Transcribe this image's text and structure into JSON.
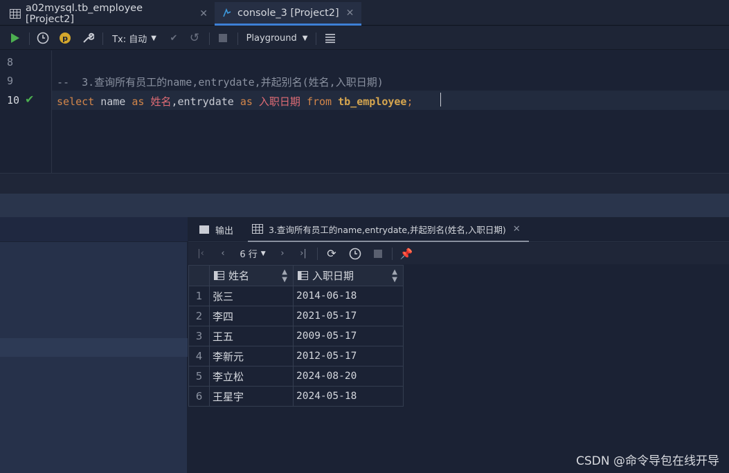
{
  "tabs": [
    {
      "label": "a02mysql.tb_employee [Project2]",
      "active": false
    },
    {
      "label": "console_3 [Project2]",
      "active": true
    }
  ],
  "toolbar": {
    "tx_label": "Tx: 自动",
    "playground_label": "Playground"
  },
  "editor": {
    "lines": [
      {
        "num": "8",
        "text": ""
      },
      {
        "num": "9",
        "text": "--  3.查询所有员工的name,entrydate,并起别名(姓名,入职日期)"
      },
      {
        "num": "10",
        "text": "select name as 姓名,entrydate as 入职日期 from tb_employee;"
      }
    ],
    "code": {
      "kw_select": "select",
      "col_name": "name",
      "kw_as1": "as",
      "alias1": "姓名",
      "comma": ",",
      "col_entrydate": "entrydate",
      "kw_as2": "as",
      "alias2": "入职日期",
      "kw_from": "from",
      "table": "tb_employee",
      "semicolon": ";"
    }
  },
  "results": {
    "tab_output": "输出",
    "tab_result": "3.查询所有员工的name,entrydate,并起别名(姓名,入职日期)",
    "rows_label": "6 行",
    "columns": [
      "姓名",
      "入职日期"
    ],
    "rows": [
      {
        "n": "1",
        "name": "张三",
        "date": "2014-06-18"
      },
      {
        "n": "2",
        "name": "李四",
        "date": "2021-05-17"
      },
      {
        "n": "3",
        "name": "王五",
        "date": "2009-05-17"
      },
      {
        "n": "4",
        "name": "李新元",
        "date": "2012-05-17"
      },
      {
        "n": "5",
        "name": "李立松",
        "date": "2024-08-20"
      },
      {
        "n": "6",
        "name": "王星宇",
        "date": "2024-05-18"
      }
    ]
  },
  "watermark": "CSDN @命令导包在线开导",
  "colors": {
    "accent": "#3d7fd6",
    "run_green": "#4caf50",
    "keyword": "#d3864a",
    "alias": "#e06c75",
    "table": "#d6a64f"
  }
}
